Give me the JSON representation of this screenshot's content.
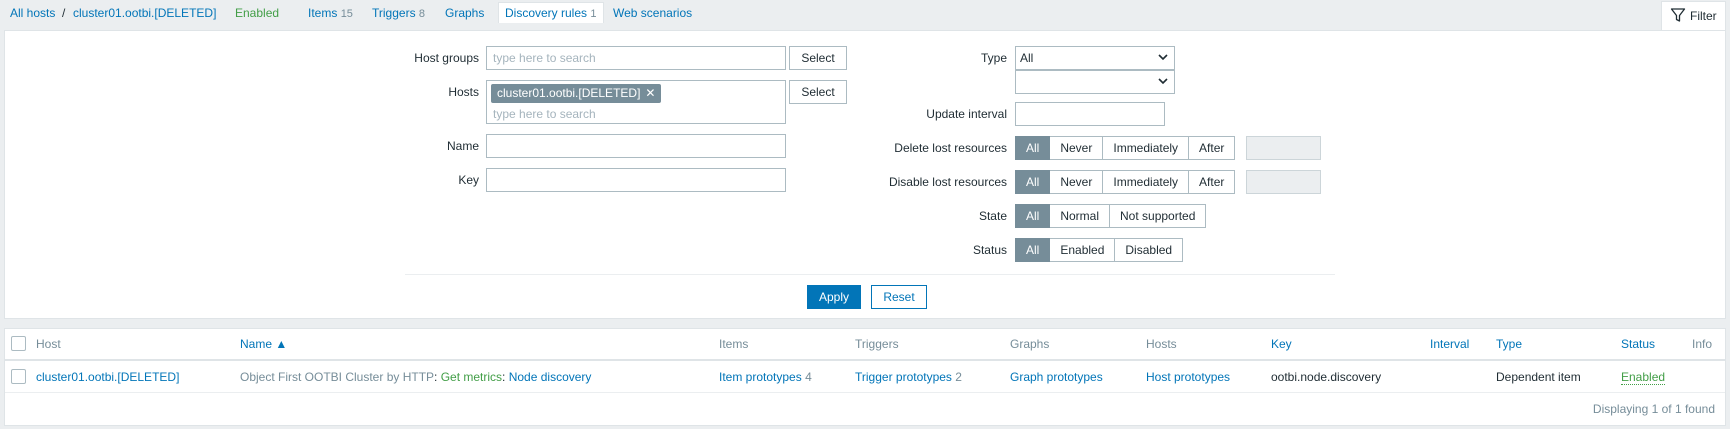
{
  "nav": {
    "all_hosts": "All hosts",
    "separator": "/",
    "host": "cluster01.ootbi.[DELETED]",
    "status": "Enabled",
    "items_label": "Items",
    "items_count": "15",
    "triggers_label": "Triggers",
    "triggers_count": "8",
    "graphs_label": "Graphs",
    "discovery_label": "Discovery rules",
    "discovery_count": "1",
    "web_label": "Web scenarios",
    "filter_label": "Filter"
  },
  "filter": {
    "host_groups_label": "Host groups",
    "host_groups_placeholder": "type here to search",
    "hosts_label": "Hosts",
    "hosts_chip": "cluster01.ootbi.[DELETED]",
    "hosts_chip_remove": "✕",
    "hosts_placeholder": "type here to search",
    "select_label": "Select",
    "name_label": "Name",
    "key_label": "Key",
    "type_label": "Type",
    "type_value": "All",
    "type_sub_value": "",
    "update_interval_label": "Update interval",
    "delete_lost_label": "Delete lost resources",
    "disable_lost_label": "Disable lost resources",
    "lost_options": [
      "All",
      "Never",
      "Immediately",
      "After"
    ],
    "state_label": "State",
    "state_options": [
      "All",
      "Normal",
      "Not supported"
    ],
    "status_label": "Status",
    "status_options": [
      "All",
      "Enabled",
      "Disabled"
    ],
    "apply_label": "Apply",
    "reset_label": "Reset"
  },
  "table": {
    "headers": {
      "host": "Host",
      "name": "Name ▲",
      "items": "Items",
      "triggers": "Triggers",
      "graphs": "Graphs",
      "hosts": "Hosts",
      "key": "Key",
      "interval": "Interval",
      "type": "Type",
      "status": "Status",
      "info": "Info"
    },
    "row": {
      "host": "cluster01.ootbi.[DELETED]",
      "name_template": "Object First OOTBI Cluster by HTTP",
      "name_sep1": ": ",
      "name_master": "Get metrics",
      "name_sep2": ": ",
      "name_rule": "Node discovery",
      "items_label": "Item prototypes",
      "items_count": "4",
      "triggers_label": "Trigger prototypes",
      "triggers_count": "2",
      "graphs_label": "Graph prototypes",
      "hosts_label": "Host prototypes",
      "key": "ootbi.node.discovery",
      "interval": "",
      "type": "Dependent item",
      "status": "Enabled"
    },
    "footer": "Displaying 1 of 1 found"
  }
}
